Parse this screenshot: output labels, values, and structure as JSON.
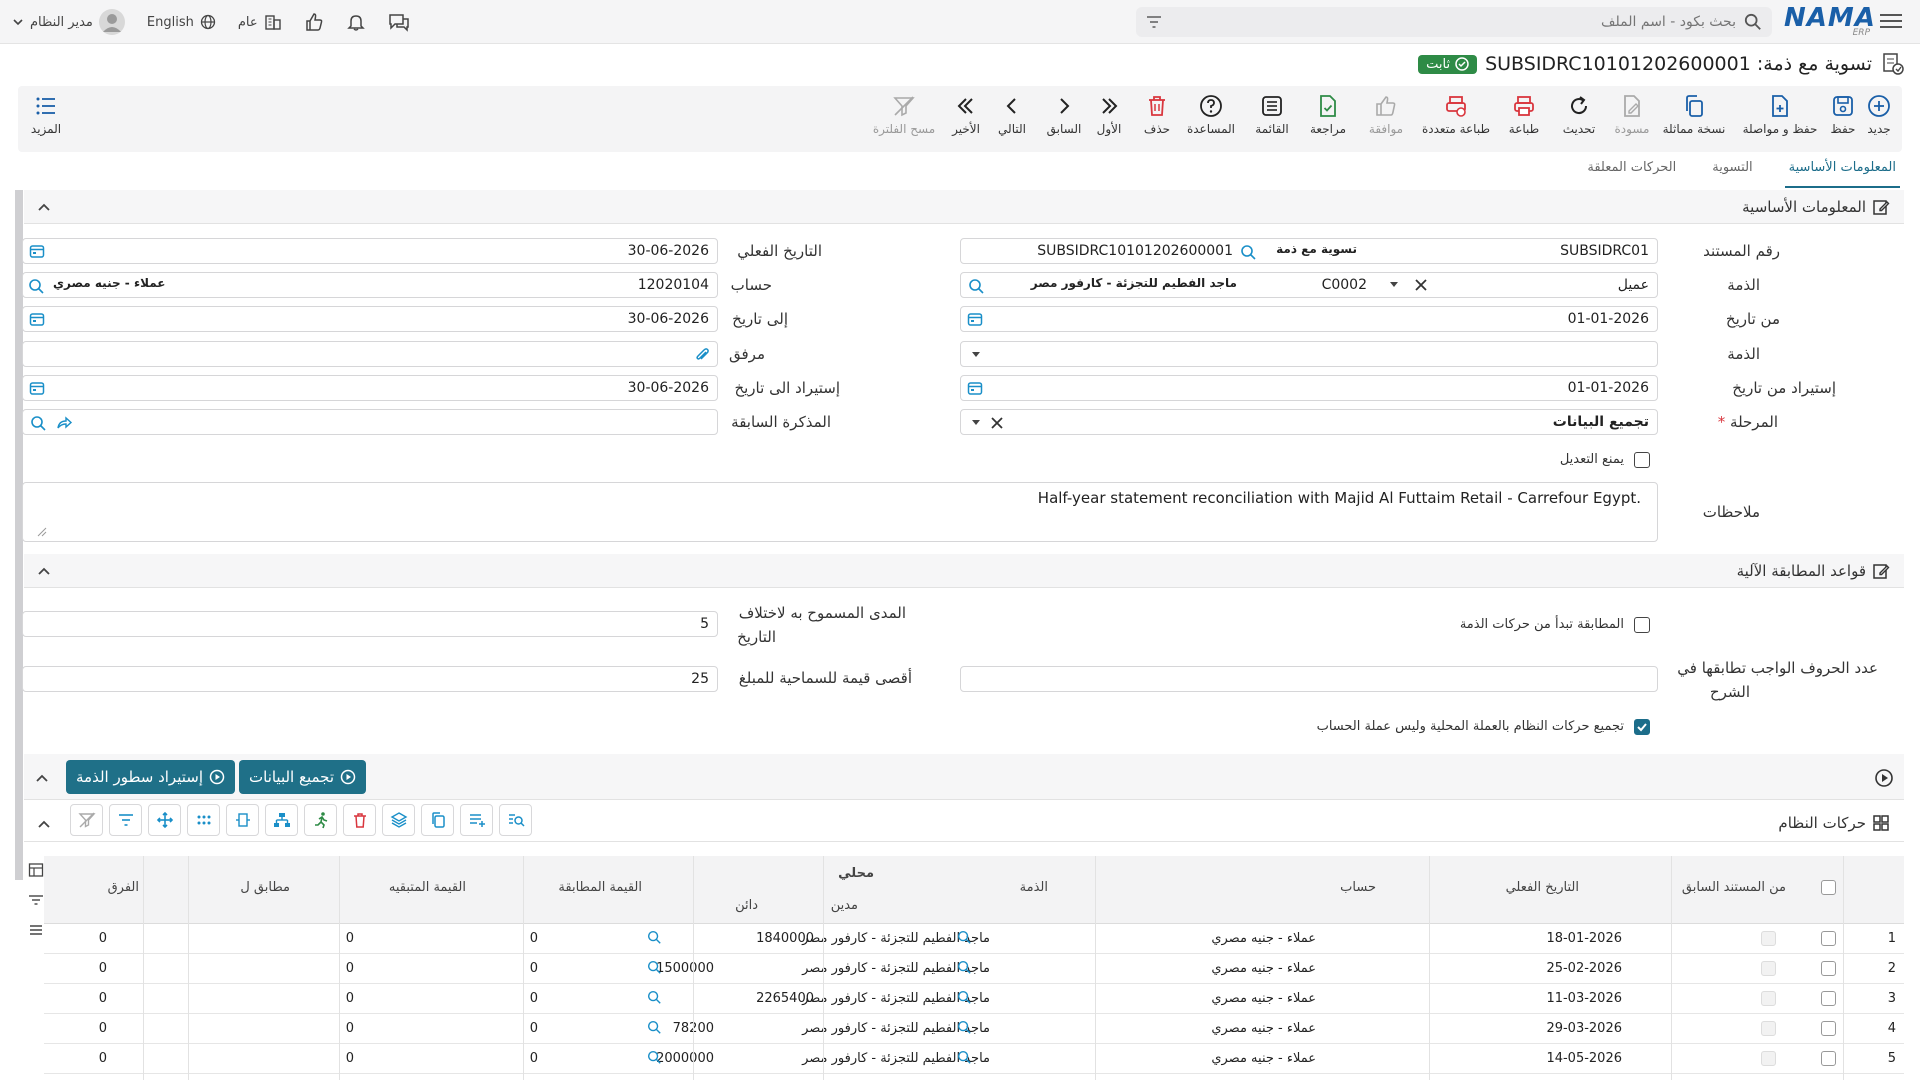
{
  "topbar": {
    "search_placeholder": "بحث بكود - اسم الملف",
    "user": "مدير النظام",
    "language": "English",
    "scope": "عام"
  },
  "logo": {
    "main": "NAMA",
    "sub": "ERP"
  },
  "title": {
    "text": "تسوية مع ذمة: SUBSIDRC10101202600001",
    "status": "ثابت"
  },
  "toolbar": {
    "new": "جديد",
    "save": "حفظ",
    "save_continue": "حفظ و مواصلة",
    "copy": "نسخة مماثلة",
    "draft": "مسودة",
    "refresh": "تحديث",
    "print": "طباعة",
    "multi_print": "طباعة متعددة",
    "approve": "موافقة",
    "review": "مراجعة",
    "list": "القائمة",
    "help": "المساعدة",
    "delete": "حذف",
    "first": "الأول",
    "prev": "السابق",
    "next": "التالي",
    "last": "الأخير",
    "clear_filter": "مسح الفلترة",
    "more": "المزيد"
  },
  "tabs": [
    "المعلومات الأساسية",
    "التسوية",
    "الحركات المعلقة"
  ],
  "sections": {
    "basic": "المعلومات الأساسية",
    "rules": "قواعد المطابقة الآلية",
    "system_moves": "حركات النظام"
  },
  "form": {
    "doc_no_label": "رقم المستند",
    "doc_no_value": "SUBSIDRC01",
    "doc_type_chip": "تسوية مع ذمة",
    "doc_code": "SUBSIDRC10101202600001",
    "actual_date_label": "التاريخ الفعلي",
    "actual_date": "30-06-2026",
    "subsidiary_label": "الذمة",
    "subsidiary_type": "عميل",
    "subsidiary_code": "C0002",
    "subsidiary_chip": "ماجد الفطيم للتجزئة - كارفور مصر",
    "account_label": "حساب",
    "account_code": "12020104",
    "account_chip": "عملاء - جنيه مصري",
    "from_date_label": "من تاريخ",
    "from_date": "01-01-2026",
    "to_date_label": "إلى تاريخ",
    "to_date": "30-06-2026",
    "subsidiary2_label": "الذمة",
    "attachment_label": "مرفق",
    "import_from_label": "إستيراد من تاريخ",
    "import_from": "01-01-2026",
    "import_to_label": "إستيراد الى تاريخ",
    "import_to": "30-06-2026",
    "stage_label": "المرحلة",
    "stage_value": "تجميع البيانات",
    "prev_memo_label": "المذكرة السابقة",
    "prevent_edit_label": "يمنع التعديل",
    "notes_label": "ملاحظات",
    "notes_value": "Half-year statement reconciliation with Majid Al Futtaim Retail - Carrefour Egypt."
  },
  "rules": {
    "match_from_sub_label": "المطابقة تبدأ من حركات الذمة",
    "date_tol_label_1": "المدى المسموح به لاختلاف",
    "date_tol_label_2": "التاريخ",
    "date_tol_value": "5",
    "chars_label_1": "عدد الحروف الواجب تطابقها في",
    "chars_label_2": "الشرح",
    "amount_tol_label": "أقصى قيمة للسماحية للمبلغ",
    "amount_tol_value": "25",
    "local_currency_label": "تجميع حركات النظام بالعملة المحلية وليس عملة الحساب"
  },
  "buttons": {
    "collect": "تجميع البيانات",
    "import_lines": "إستيراد سطور الذمة"
  },
  "table": {
    "columns": {
      "prev_doc": "من المستند السابق",
      "actual_date": "التاريخ الفعلي",
      "account": "حساب",
      "subsidiary": "الذمة",
      "local": "محلي",
      "debit": "مدين",
      "credit": "دائن",
      "matched": "القيمة المطابقة",
      "remaining": "القيمة المتبقيه",
      "matched_with": "مطابق ل",
      "diff": "الفرق"
    },
    "rows": [
      {
        "n": "1",
        "date": "18-01-2026",
        "account": "عملاء - جنيه مصري",
        "sub": "ماجد الفطيم للتجزئة - كارفور مصر",
        "debit": "1840000",
        "credit": "",
        "matched": "0",
        "remaining": "0",
        "diff": "0"
      },
      {
        "n": "2",
        "date": "25-02-2026",
        "account": "عملاء - جنيه مصري",
        "sub": "ماجد الفطيم للتجزئة - كارفور مصر",
        "debit": "",
        "credit": "1500000",
        "matched": "0",
        "remaining": "0",
        "diff": "0"
      },
      {
        "n": "3",
        "date": "11-03-2026",
        "account": "عملاء - جنيه مصري",
        "sub": "ماجد الفطيم للتجزئة - كارفور مصر",
        "debit": "2265400",
        "credit": "",
        "matched": "0",
        "remaining": "0",
        "diff": "0"
      },
      {
        "n": "4",
        "date": "29-03-2026",
        "account": "عملاء - جنيه مصري",
        "sub": "ماجد الفطيم للتجزئة - كارفور مصر",
        "debit": "",
        "credit": "78200",
        "matched": "0",
        "remaining": "0",
        "diff": "0"
      },
      {
        "n": "5",
        "date": "14-05-2026",
        "account": "عملاء - جنيه مصري",
        "sub": "ماجد الفطيم للتجزئة - كارفور مصر",
        "debit": "",
        "credit": "2000000",
        "matched": "0",
        "remaining": "0",
        "diff": "0"
      }
    ]
  },
  "colors": {
    "accent": "#1f7088",
    "success": "#2e8b46",
    "danger": "#d9363e",
    "link": "#1a5fa8"
  }
}
